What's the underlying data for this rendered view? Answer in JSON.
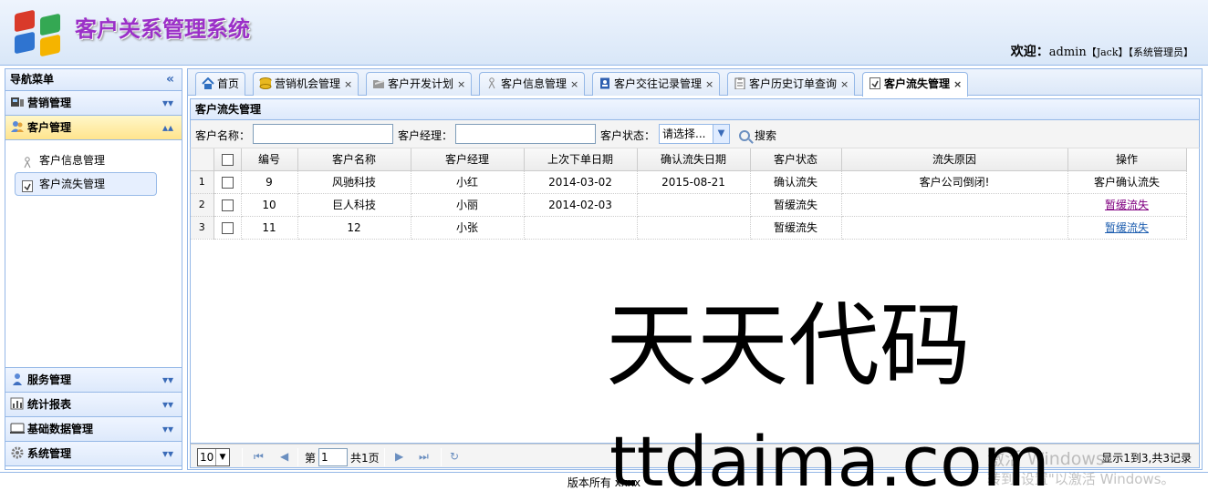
{
  "app": {
    "title": "客户关系管理系统",
    "welcome_label": "欢迎：",
    "user": "admin",
    "user_name": "【Jack】",
    "user_role": "【系统管理员】"
  },
  "sidebar": {
    "title": "导航菜单",
    "collapse_symbol": "«",
    "sections": [
      {
        "label": "营销管理",
        "icon": "marketing-icon"
      },
      {
        "label": "客户管理",
        "icon": "customers-icon"
      },
      {
        "label": "服务管理",
        "icon": "service-icon"
      },
      {
        "label": "统计报表",
        "icon": "report-icon"
      },
      {
        "label": "基础数据管理",
        "icon": "base-data-icon"
      },
      {
        "label": "系统管理",
        "icon": "system-icon"
      }
    ],
    "items": [
      {
        "label": "客户信息管理",
        "icon": "customer-info-icon"
      },
      {
        "label": "客户流失管理",
        "icon": "customer-loss-icon"
      }
    ]
  },
  "tabs": [
    {
      "label": "首页",
      "icon": "home-icon"
    },
    {
      "label": "营销机会管理",
      "icon": "coins-icon"
    },
    {
      "label": "客户开发计划",
      "icon": "folder-icon"
    },
    {
      "label": "客户信息管理",
      "icon": "customer-info-icon"
    },
    {
      "label": "客户交往记录管理",
      "icon": "contact-book-icon"
    },
    {
      "label": "客户历史订单查询",
      "icon": "clipboard-icon"
    },
    {
      "label": "客户流失管理",
      "icon": "customer-loss-icon"
    }
  ],
  "panel": {
    "title": "客户流失管理",
    "search": {
      "name_label": "客户名称：",
      "manager_label": "客户经理：",
      "status_label": "客户状态：",
      "status_value": "请选择...",
      "search_label": "搜索"
    }
  },
  "table": {
    "columns": [
      "编号",
      "客户名称",
      "客户经理",
      "上次下单日期",
      "确认流失日期",
      "客户状态",
      "流失原因",
      "操作"
    ],
    "rows": [
      {
        "rn": "1",
        "id": "9",
        "name": "风驰科技",
        "manager": "小红",
        "last_order": "2014-03-02",
        "confirm_date": "2015-08-21",
        "status": "确认流失",
        "reason": "客户公司倒闭!",
        "action": "客户确认流失"
      },
      {
        "rn": "2",
        "id": "10",
        "name": "巨人科技",
        "manager": "小丽",
        "last_order": "2014-02-03",
        "confirm_date": "",
        "status": "暂缓流失",
        "reason": "",
        "action": "暂缓流失"
      },
      {
        "rn": "3",
        "id": "11",
        "name": "12",
        "manager": "小张",
        "last_order": "",
        "confirm_date": "",
        "status": "暂缓流失",
        "reason": "",
        "action": "暂缓流失"
      }
    ]
  },
  "pager": {
    "page_size": "10",
    "page_prefix": "第",
    "page_value": "1",
    "page_suffix": "共1页",
    "info": "显示1到3,共3记录"
  },
  "footer": {
    "text": "版本所有 xxxx"
  },
  "watermark": {
    "line1": "天天代码",
    "line2": "ttdaima.com"
  },
  "windows_activation": {
    "line1": "激活 Windows",
    "line2": "转到\"设置\"以激活 Windows。"
  }
}
